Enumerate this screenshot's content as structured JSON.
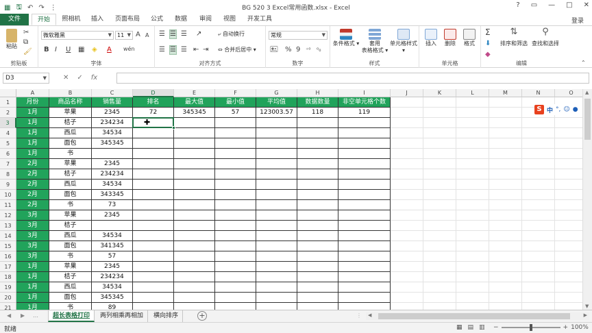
{
  "window": {
    "title": "BG 520 3 Excel常用函数.xlsx - Excel",
    "controls": [
      "?",
      "▭",
      "—",
      "□",
      "✕"
    ],
    "login": "登录"
  },
  "qat": {
    "save_icon": "save-icon",
    "undo_icon": "undo-icon",
    "redo_icon": "redo-icon"
  },
  "tabs": [
    "文件",
    "开始",
    "照相机",
    "插入",
    "页面布局",
    "公式",
    "数据",
    "审阅",
    "视图",
    "开发工具"
  ],
  "ribbon": {
    "clipboard": {
      "paste": "粘贴",
      "label": "剪贴板"
    },
    "font": {
      "name": "微软雅黑",
      "size": "11",
      "grow": "A",
      "shrink": "A",
      "bold": "B",
      "italic": "I",
      "underline": "U",
      "label": "字体",
      "wen": "wén",
      "font_color_letter": "A"
    },
    "align": {
      "wrap": "自动换行",
      "merge": "合并后居中",
      "label": "对齐方式"
    },
    "number": {
      "format": "常规",
      "percent": "%",
      "comma": "9",
      "label": "数字"
    },
    "styles": {
      "cond": "条件格式",
      "table1": "套用",
      "table2": "表格格式",
      "cell": "单元格样式",
      "label": "样式"
    },
    "cells": {
      "insert": "插入",
      "delete": "删除",
      "format": "格式",
      "label": "单元格"
    },
    "editing": {
      "sort": "排序和筛选",
      "find": "查找和选择",
      "label": "编辑",
      "sum": "Σ"
    }
  },
  "formula_bar": {
    "name_box": "D3",
    "cancel": "✕",
    "enter": "✓",
    "fx": "fx",
    "value": ""
  },
  "columns": [
    "A",
    "B",
    "C",
    "D",
    "E",
    "F",
    "G",
    "H",
    "I",
    "J",
    "K",
    "L",
    "M",
    "N",
    "O"
  ],
  "rows": [
    "1",
    "2",
    "3",
    "4",
    "5",
    "6",
    "7",
    "8",
    "9",
    "10",
    "11",
    "12",
    "13",
    "14",
    "15",
    "16",
    "17",
    "18",
    "19",
    "20",
    "21"
  ],
  "header_row": [
    "月份",
    "商品名称",
    "销售量",
    "排名",
    "最大值",
    "最小值",
    "平均值",
    "数据数量",
    "非空单元格个数"
  ],
  "stats_row": [
    "72",
    "345345",
    "57",
    "123003.57",
    "118",
    "119"
  ],
  "data_rows": [
    [
      "1月",
      "苹果",
      "2345"
    ],
    [
      "1月",
      "桔子",
      "234234"
    ],
    [
      "1月",
      "西瓜",
      "34534"
    ],
    [
      "1月",
      "面包",
      "345345"
    ],
    [
      "1月",
      "书",
      ""
    ],
    [
      "2月",
      "苹果",
      "2345"
    ],
    [
      "2月",
      "桔子",
      "234234"
    ],
    [
      "2月",
      "西瓜",
      "34534"
    ],
    [
      "2月",
      "面包",
      "343345"
    ],
    [
      "2月",
      "书",
      "73"
    ],
    [
      "3月",
      "苹果",
      "2345"
    ],
    [
      "3月",
      "桔子",
      ""
    ],
    [
      "3月",
      "西瓜",
      "34534"
    ],
    [
      "3月",
      "面包",
      "341345"
    ],
    [
      "3月",
      "书",
      "57"
    ],
    [
      "1月",
      "苹果",
      "2345"
    ],
    [
      "1月",
      "桔子",
      "234234"
    ],
    [
      "1月",
      "西瓜",
      "34534"
    ],
    [
      "1月",
      "面包",
      "345345"
    ],
    [
      "1月",
      "书",
      "89"
    ]
  ],
  "ime": {
    "logo": "S",
    "lang": "中",
    "punct": "°,",
    "emoji": "☺",
    "mic": "🎤"
  },
  "sheets": [
    "超长表格打印",
    "两列相乘再相加",
    "横向排序"
  ],
  "sheet_add": "+",
  "sheet_nav": [
    "◀",
    "▶",
    "…"
  ],
  "status": {
    "mode": "就绪",
    "zoom_minus": "−",
    "zoom_plus": "+",
    "zoom": "100%"
  },
  "colors": {
    "accent": "#217346",
    "header_fill": "#21a35b"
  }
}
